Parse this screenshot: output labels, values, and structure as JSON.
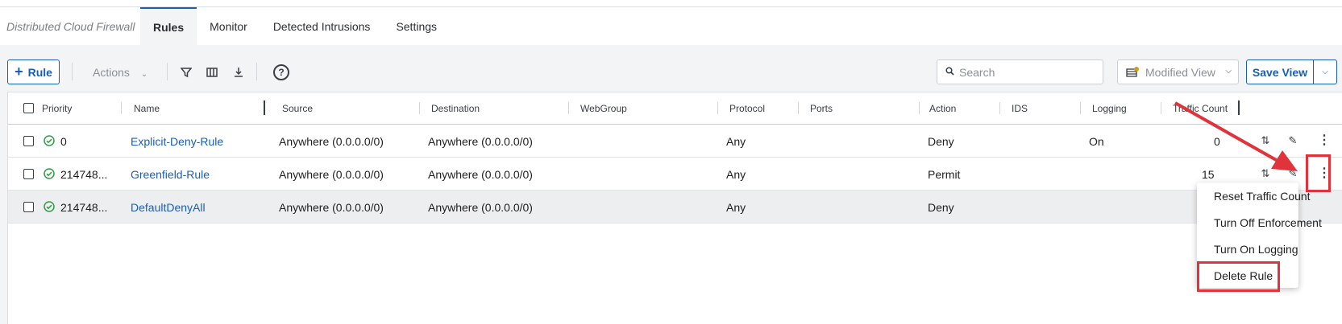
{
  "app": {
    "title": "Distributed Cloud Firewall"
  },
  "tabs": [
    {
      "label": "Rules",
      "active": true
    },
    {
      "label": "Monitor",
      "active": false
    },
    {
      "label": "Detected Intrusions",
      "active": false
    },
    {
      "label": "Settings",
      "active": false
    }
  ],
  "toolbar": {
    "add_rule_label": "Rule",
    "actions_label": "Actions",
    "search_placeholder": "Search",
    "view_label": "Modified View",
    "save_view_label": "Save View"
  },
  "table": {
    "columns": [
      "Priority",
      "Name",
      "Source",
      "Destination",
      "WebGroup",
      "Protocol",
      "Ports",
      "Action",
      "IDS",
      "Logging",
      "Traffic Count"
    ],
    "rows": [
      {
        "priority": "0",
        "name": "Explicit-Deny-Rule",
        "source": "Anywhere (0.0.0.0/0)",
        "destination": "Anywhere (0.0.0.0/0)",
        "webgroup": "",
        "protocol": "Any",
        "ports": "",
        "action": "Deny",
        "ids": "",
        "logging": "On",
        "traffic_count": "0"
      },
      {
        "priority": "214748...",
        "name": "Greenfield-Rule",
        "source": "Anywhere (0.0.0.0/0)",
        "destination": "Anywhere (0.0.0.0/0)",
        "webgroup": "",
        "protocol": "Any",
        "ports": "",
        "action": "Permit",
        "ids": "",
        "logging": "",
        "traffic_count": "15"
      },
      {
        "priority": "214748...",
        "name": "DefaultDenyAll",
        "source": "Anywhere (0.0.0.0/0)",
        "destination": "Anywhere (0.0.0.0/0)",
        "webgroup": "",
        "protocol": "Any",
        "ports": "",
        "action": "Deny",
        "ids": "",
        "logging": "",
        "traffic_count": ""
      }
    ]
  },
  "context_menu": {
    "items": [
      "Reset Traffic Count",
      "Turn Off Enforcement",
      "Turn On Logging",
      "Delete Rule"
    ]
  },
  "colors": {
    "accent": "#1a5fb4",
    "status_ok": "#2e9e44",
    "highlight": "#e0333b",
    "view_dot": "#d49a1e"
  }
}
